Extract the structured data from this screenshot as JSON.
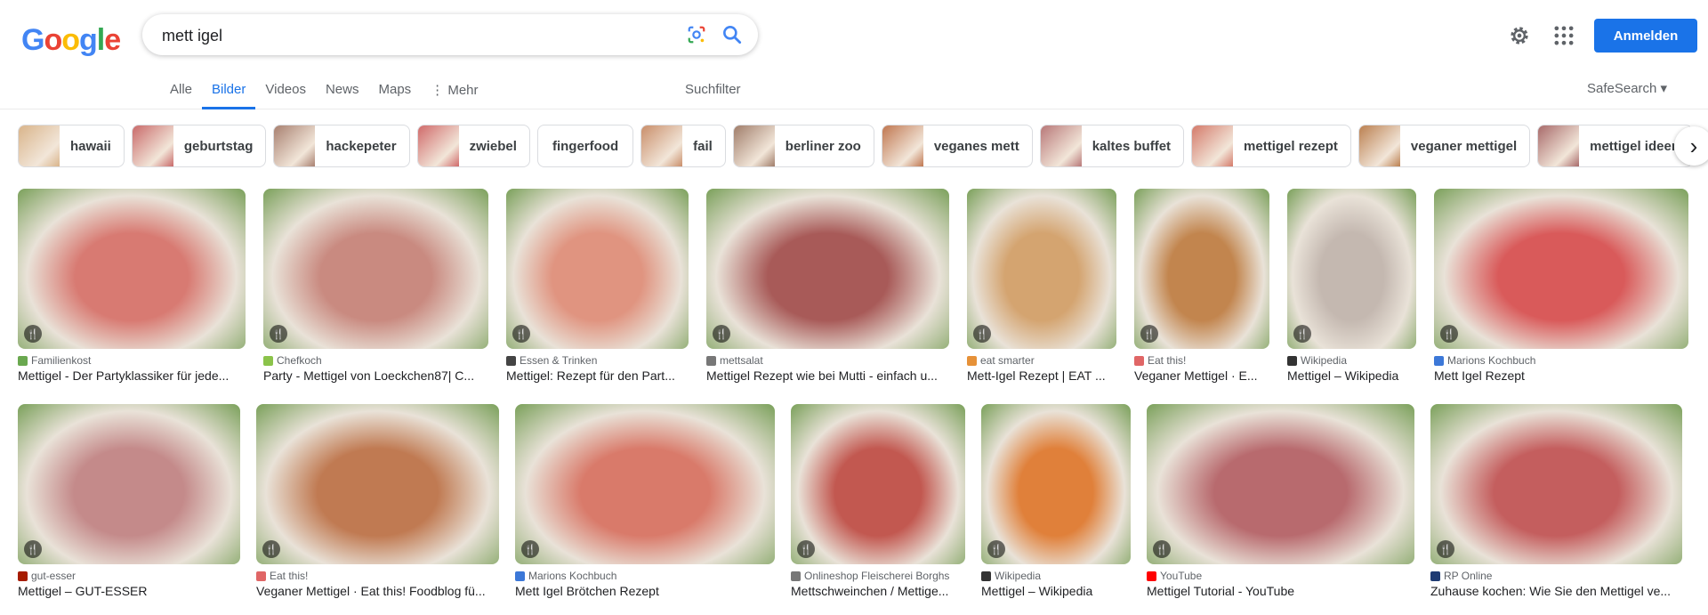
{
  "logo": {
    "letters": [
      "G",
      "o",
      "o",
      "g",
      "l",
      "e"
    ]
  },
  "search": {
    "query": "mett igel"
  },
  "header": {
    "signin_label": "Anmelden"
  },
  "tabs": [
    "Alle",
    "Bilder",
    "Videos",
    "News",
    "Maps",
    "⋮ Mehr"
  ],
  "tools_label": "Suchfilter",
  "safesearch_label": "SafeSearch ▾",
  "chips": [
    {
      "label": "hawaii",
      "color": "#d9b48a"
    },
    {
      "label": "geburtstag",
      "color": "#c96a6a"
    },
    {
      "label": "hackepeter",
      "color": "#a88070"
    },
    {
      "label": "zwiebel",
      "color": "#d06a6a"
    },
    {
      "label": "fingerfood",
      "color": ""
    },
    {
      "label": "fail",
      "color": "#c98e6a"
    },
    {
      "label": "berliner zoo",
      "color": "#a07d6a"
    },
    {
      "label": "veganes mett",
      "color": "#c07750"
    },
    {
      "label": "kaltes buffet",
      "color": "#b87878"
    },
    {
      "label": "mettigel rezept",
      "color": "#d47a6a"
    },
    {
      "label": "veganer mettigel",
      "color": "#bb8050"
    },
    {
      "label": "mettigel ideen",
      "color": "#a86a6a"
    }
  ],
  "row1": [
    {
      "source": "Familienkost",
      "title": "Mettigel - Der Partyklassiker für jede...",
      "color": "#d87a72",
      "fav": "#6aa84f",
      "w": 256
    },
    {
      "source": "Chefkoch",
      "title": "Party - Mettigel von Loeckchen87| C...",
      "color": "#c98a80",
      "fav": "#8bc34a",
      "w": 253
    },
    {
      "source": "Essen & Trinken",
      "title": "Mettigel: Rezept für den Part...",
      "color": "#e09480",
      "fav": "#444444",
      "w": 205
    },
    {
      "source": "mettsalat",
      "title": "Mettigel Rezept wie bei Mutti - einfach u...",
      "color": "#a85a58",
      "fav": "#777777",
      "w": 273
    },
    {
      "source": "eat smarter",
      "title": "Mett-Igel Rezept | EAT ...",
      "color": "#d4a470",
      "fav": "#e69138",
      "w": 168
    },
    {
      "source": "Eat this!",
      "title": "Veganer Mettigel · E...",
      "color": "#c2854e",
      "fav": "#e06666",
      "w": 152
    },
    {
      "source": "Wikipedia",
      "title": "Mettigel – Wikipedia",
      "color": "#c4b8b0",
      "fav": "#333333",
      "w": 145
    },
    {
      "source": "Marions Kochbuch",
      "title": "Mett Igel Rezept",
      "color": "#d95a5a",
      "fav": "#3c78d8",
      "w": 286
    }
  ],
  "row2": [
    {
      "source": "gut-esser",
      "title": "Mettigel – GUT-ESSER",
      "color": "#c48a8a",
      "fav": "#a61c00",
      "w": 250
    },
    {
      "source": "Eat this!",
      "title": "Veganer Mettigel · Eat this! Foodblog fü...",
      "color": "#c07a52",
      "fav": "#e06666",
      "w": 273
    },
    {
      "source": "Marions Kochbuch",
      "title": "Mett Igel Brötchen Rezept",
      "color": "#d97a6a",
      "fav": "#3c78d8",
      "w": 292
    },
    {
      "source": "Onlineshop Fleischerei Borghs",
      "title": "Mettschweinchen / Mettige...",
      "color": "#c25850",
      "fav": "#777777",
      "w": 196
    },
    {
      "source": "Wikipedia",
      "title": "Mettigel – Wikipedia",
      "color": "#e0803a",
      "fav": "#333333",
      "w": 168
    },
    {
      "source": "YouTube",
      "title": "Mettigel Tutorial - YouTube",
      "color": "#b86a6e",
      "fav": "#ff0000",
      "w": 301
    },
    {
      "source": "RP Online",
      "title": "Zuhause kochen: Wie Sie den Mettigel ve...",
      "color": "#c45e5e",
      "fav": "#1f3b73",
      "w": 283
    }
  ]
}
